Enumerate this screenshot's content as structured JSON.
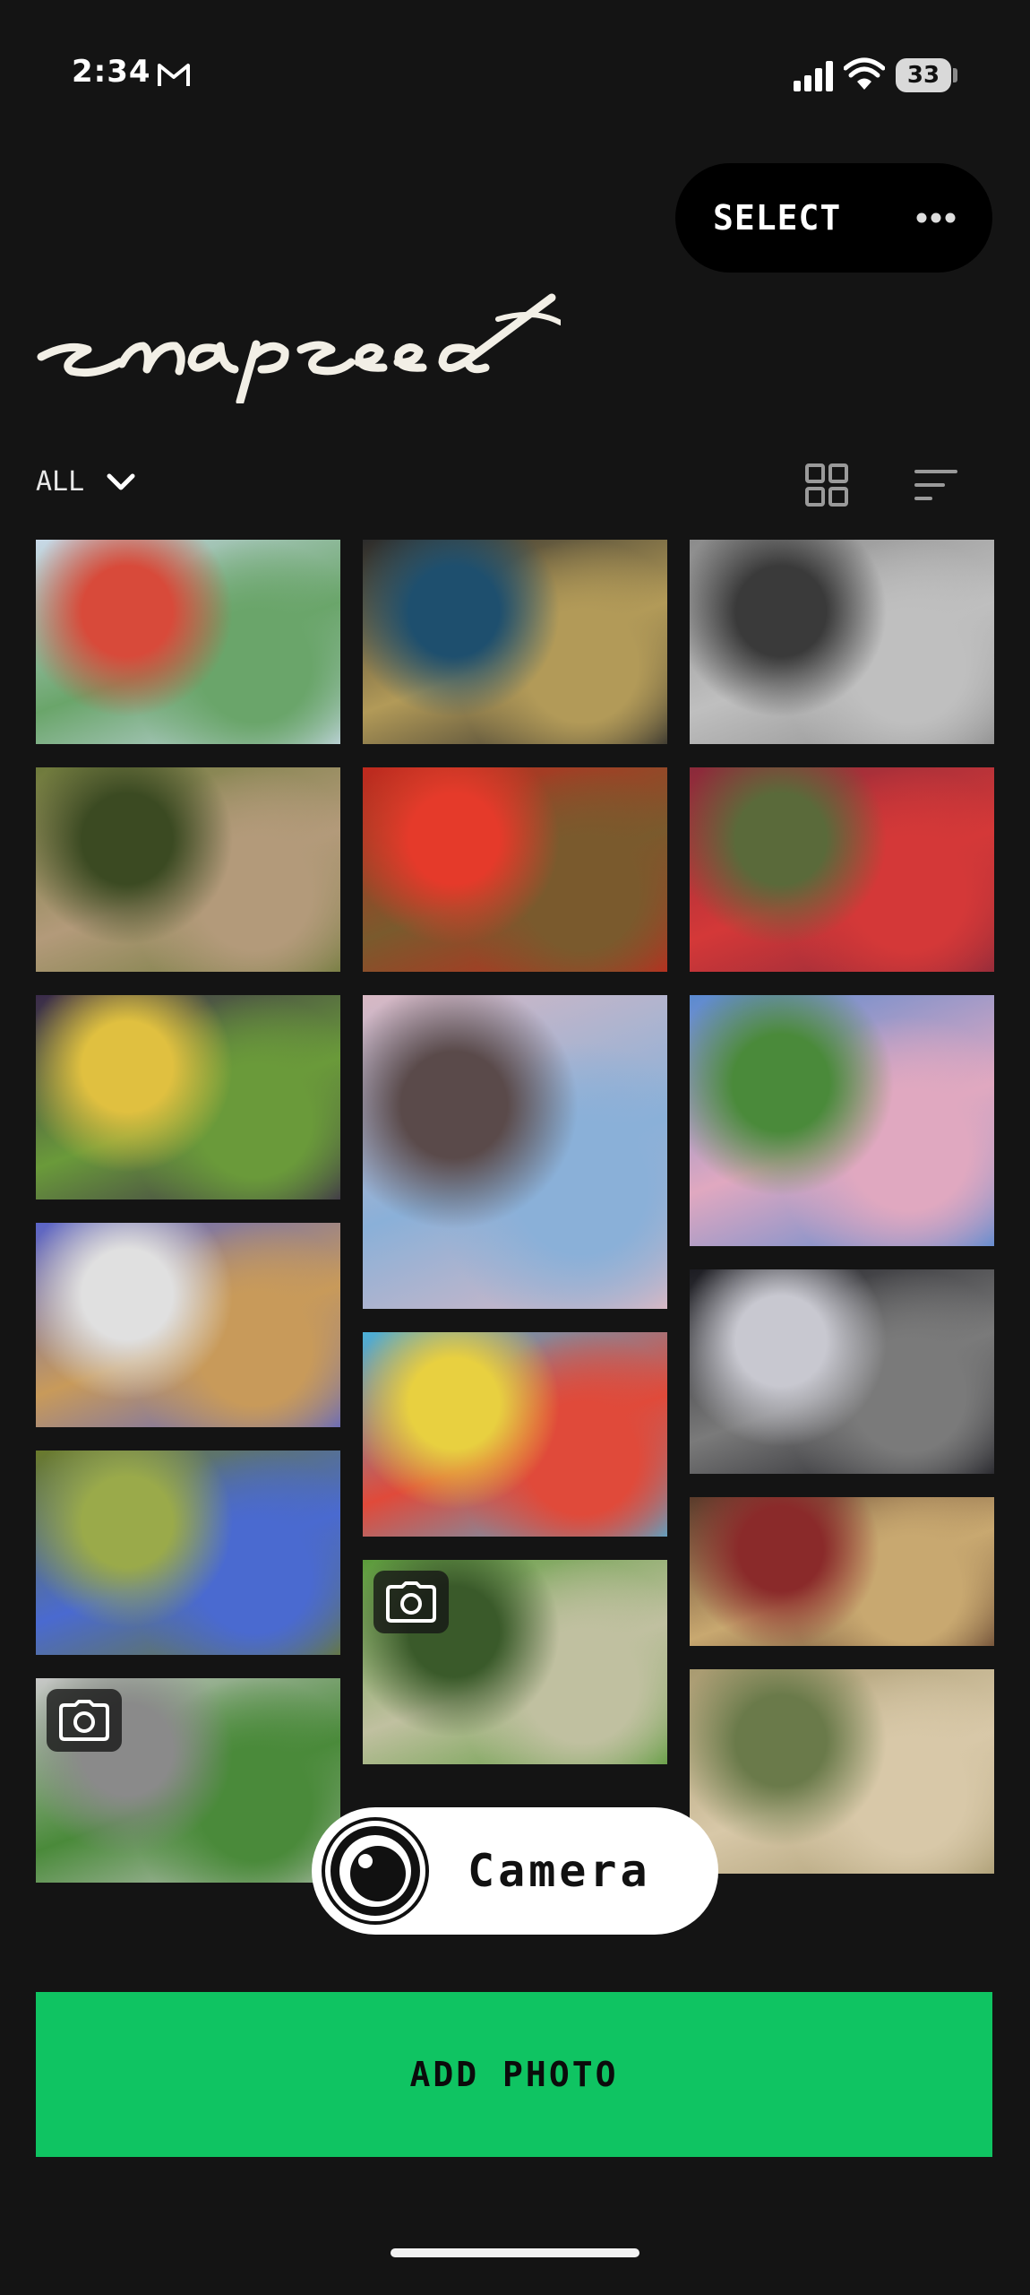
{
  "status_bar": {
    "time": "2:34",
    "battery": "33",
    "mail_icon": "gmail-icon"
  },
  "header": {
    "select_label": "SELECT",
    "more_icon": "more-horizontal-icon",
    "logo_text": "snapseed"
  },
  "filter": {
    "label": "ALL",
    "icons": [
      "chevron-down-icon",
      "grid-view-icon",
      "sort-icon"
    ]
  },
  "photos": [
    {
      "name": "photo-grocery-shelf",
      "col": 0,
      "row": 0,
      "camera": false,
      "colors": [
        "#c9d9e8",
        "#6aa56a",
        "#d84a3a"
      ]
    },
    {
      "name": "photo-bowling-alley",
      "col": 1,
      "row": 0,
      "camera": false,
      "colors": [
        "#2b2b2b",
        "#b29a58",
        "#1e4f6e"
      ]
    },
    {
      "name": "photo-grill",
      "col": 2,
      "row": 0,
      "camera": false,
      "colors": [
        "#8b8b8b",
        "#bfbfbf",
        "#3a3a3a"
      ]
    },
    {
      "name": "photo-tree-foliage",
      "col": 0,
      "row": 1,
      "camera": false,
      "colors": [
        "#6e7a3b",
        "#b39a7a",
        "#3b4a22"
      ]
    },
    {
      "name": "photo-red-peppers",
      "col": 1,
      "row": 1,
      "camera": false,
      "colors": [
        "#c0291e",
        "#7a5a2d",
        "#e53a2a"
      ]
    },
    {
      "name": "photo-fruit-stand",
      "col": 2,
      "row": 1,
      "camera": false,
      "colors": [
        "#8a2a3a",
        "#d43838",
        "#5a6a3a"
      ]
    },
    {
      "name": "photo-eggplants",
      "col": 0,
      "row": 2,
      "camera": false,
      "colors": [
        "#3a2a4a",
        "#6a9a3a",
        "#e0c040"
      ]
    },
    {
      "name": "photo-cherry-blossom-branches",
      "col": 1,
      "row": 2,
      "camera": false,
      "colors": [
        "#d8b8c4",
        "#8ab0d8",
        "#5a4a4a"
      ]
    },
    {
      "name": "photo-cherry-tree-park",
      "col": 2,
      "row": 2,
      "camera": false,
      "colors": [
        "#5a8ad0",
        "#e0a8c0",
        "#4a8a3a"
      ]
    },
    {
      "name": "photo-mall-ceiling",
      "col": 0,
      "row": 3,
      "camera": false,
      "colors": [
        "#5a64c8",
        "#c89a5a",
        "#e0e0e0"
      ]
    },
    {
      "name": "photo-ball-pit",
      "col": 1,
      "row": 3,
      "camera": false,
      "colors": [
        "#4ab0d8",
        "#e04a3a",
        "#e8d040"
      ]
    },
    {
      "name": "photo-gas-station-night",
      "col": 2,
      "row": 3,
      "camera": false,
      "colors": [
        "#1c1c22",
        "#7a7a7a",
        "#c8c8d0"
      ]
    },
    {
      "name": "photo-evergreen-tree",
      "col": 0,
      "row": 4,
      "camera": false,
      "colors": [
        "#6a7a2a",
        "#4a6ad0",
        "#9aaa4a"
      ]
    },
    {
      "name": "photo-forest-lawn",
      "col": 1,
      "row": 4,
      "camera": true,
      "colors": [
        "#5a9a3a",
        "#c0c0a0",
        "#3a5a2a"
      ]
    },
    {
      "name": "photo-restaurant-interior",
      "col": 2,
      "row": 4,
      "camera": false,
      "colors": [
        "#5a3a2a",
        "#c8a870",
        "#8a2a2a"
      ]
    },
    {
      "name": "photo-street-curb",
      "col": 0,
      "row": 5,
      "camera": true,
      "colors": [
        "#c8c8c8",
        "#4a8a3a",
        "#8a8a8a"
      ]
    },
    {
      "name": "photo-curb-sepia",
      "col": 2,
      "row": 5,
      "camera": false,
      "colors": [
        "#a89a70",
        "#d8c8a8",
        "#6a7a4a"
      ]
    }
  ],
  "camera_button": {
    "label": "Camera"
  },
  "add_photo": {
    "label": "ADD PHOTO"
  },
  "accent": "#0fc462"
}
